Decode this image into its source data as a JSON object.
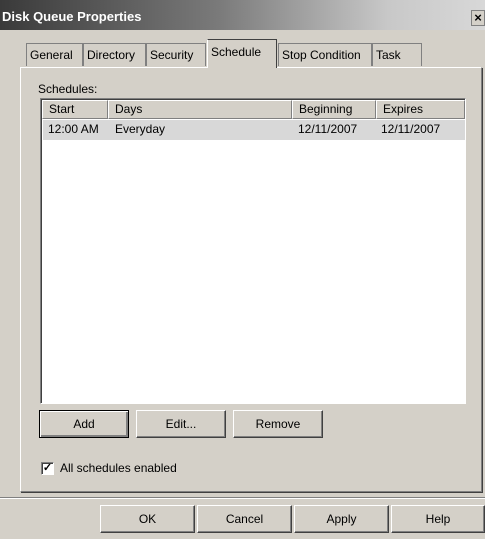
{
  "window": {
    "title": "Disk Queue Properties",
    "close_glyph": "×"
  },
  "tabs": [
    {
      "label": "General",
      "active": false
    },
    {
      "label": "Directory",
      "active": false
    },
    {
      "label": "Security",
      "active": false
    },
    {
      "label": "Schedule",
      "active": true
    },
    {
      "label": "Stop Condition",
      "active": false
    },
    {
      "label": "Task",
      "active": false
    }
  ],
  "schedules": {
    "label": "Schedules:",
    "columns": [
      "Start",
      "Days",
      "Beginning",
      "Expires"
    ],
    "rows": [
      {
        "start": "12:00 AM",
        "days": "Everyday",
        "beginning": "12/11/2007",
        "expires": "12/11/2007",
        "selected": true
      }
    ],
    "buttons": {
      "add": "Add",
      "edit": "Edit...",
      "remove": "Remove"
    },
    "all_enabled": {
      "label": "All schedules enabled",
      "checked": true,
      "check_glyph": "✓"
    }
  },
  "dialog_buttons": {
    "ok": "OK",
    "cancel": "Cancel",
    "apply": "Apply",
    "help": "Help"
  },
  "colors": {
    "title_gradient_start": "#3a3a3a",
    "face": "#d4d0c8",
    "selection": "#d8d8d8"
  }
}
